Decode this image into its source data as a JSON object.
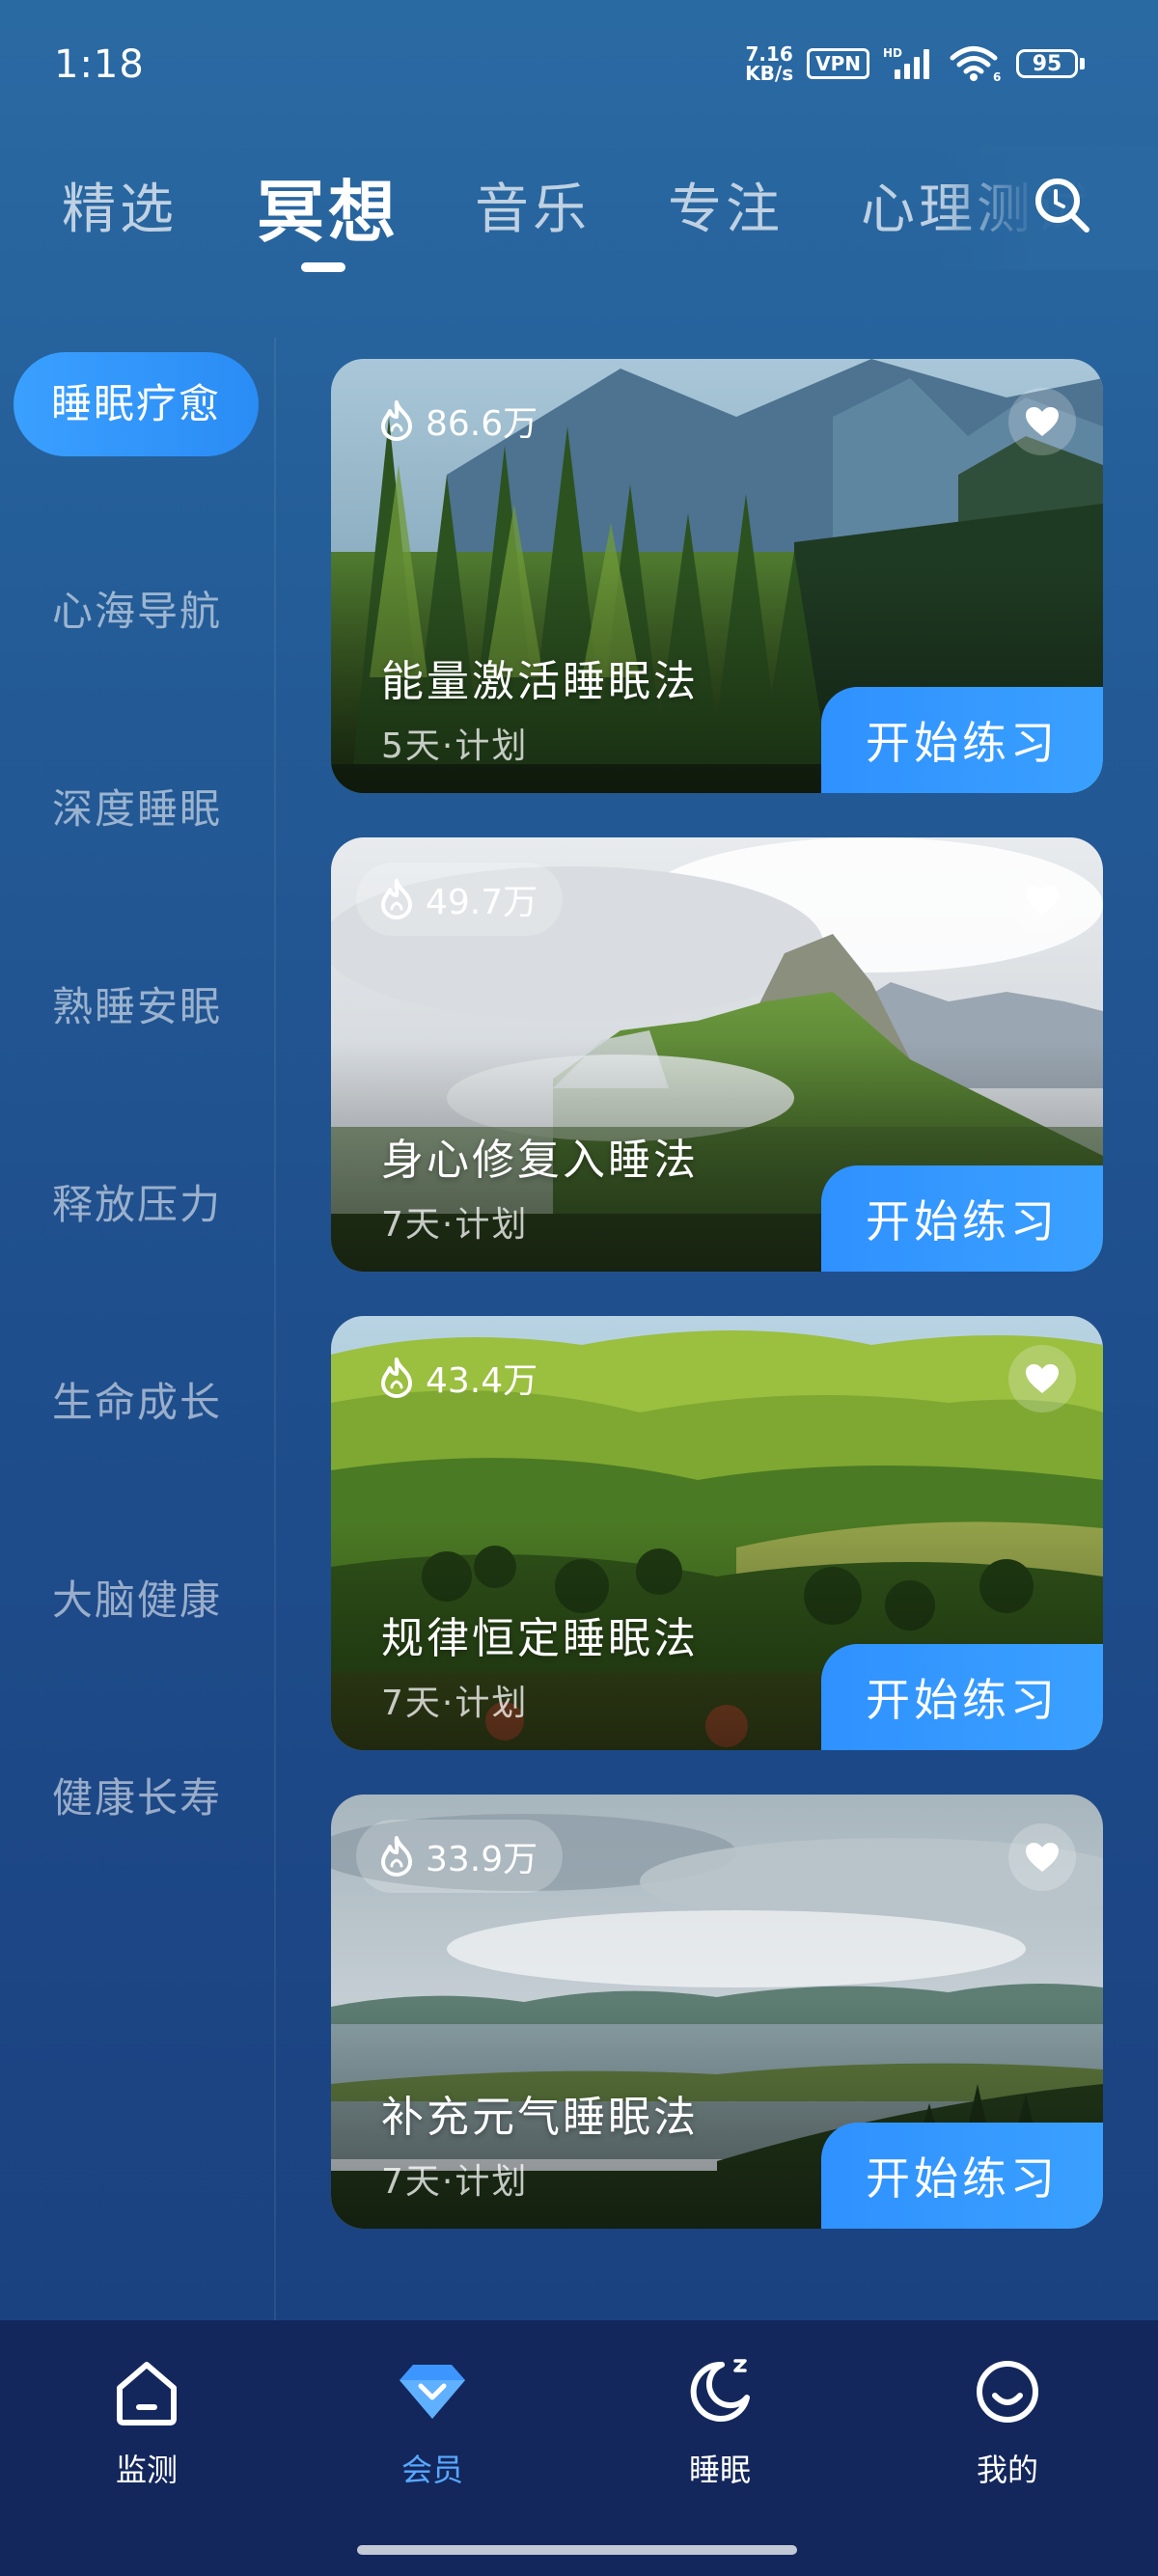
{
  "status_bar": {
    "time": "1:18",
    "net_speed_value": "7.16",
    "net_speed_unit": "KB/s",
    "vpn": "VPN",
    "hd": "HD",
    "wifi_sub": "6",
    "battery": "95"
  },
  "top_tabs": [
    {
      "label": "精选",
      "active": false
    },
    {
      "label": "冥想",
      "active": true
    },
    {
      "label": "音乐",
      "active": false
    },
    {
      "label": "专注",
      "active": false
    },
    {
      "label": "心理测试",
      "active": false
    }
  ],
  "sidebar": {
    "items": [
      {
        "label": "睡眠疗愈",
        "active": true
      },
      {
        "label": "心海导航",
        "active": false
      },
      {
        "label": "深度睡眠",
        "active": false
      },
      {
        "label": "熟睡安眠",
        "active": false
      },
      {
        "label": "释放压力",
        "active": false
      },
      {
        "label": "生命成长",
        "active": false
      },
      {
        "label": "大脑健康",
        "active": false
      },
      {
        "label": "健康长寿",
        "active": false
      }
    ]
  },
  "cards": [
    {
      "count": "86.6万",
      "title": "能量激活睡眠法",
      "subtitle": "5天·计划",
      "button": "开始练习",
      "scene": "forest-mountains"
    },
    {
      "count": "49.7万",
      "title": "身心修复入睡法",
      "subtitle": "7天·计划",
      "button": "开始练习",
      "scene": "misty-ridge"
    },
    {
      "count": "43.4万",
      "title": "规律恒定睡眠法",
      "subtitle": "7天·计划",
      "button": "开始练习",
      "scene": "green-hills"
    },
    {
      "count": "33.9万",
      "title": "补充元气睡眠法",
      "subtitle": "7天·计划",
      "button": "开始练习",
      "scene": "lake-shore"
    }
  ],
  "bottom_nav": [
    {
      "label": "监测",
      "icon": "home-icon",
      "active": false
    },
    {
      "label": "会员",
      "icon": "diamond-icon",
      "active": true
    },
    {
      "label": "睡眠",
      "icon": "moon-icon",
      "active": false
    },
    {
      "label": "我的",
      "icon": "smile-icon",
      "active": false
    }
  ],
  "colors": {
    "accent": "#3aa0ff",
    "active_nav": "#57a8ff",
    "nav_bg": "#13275c"
  }
}
